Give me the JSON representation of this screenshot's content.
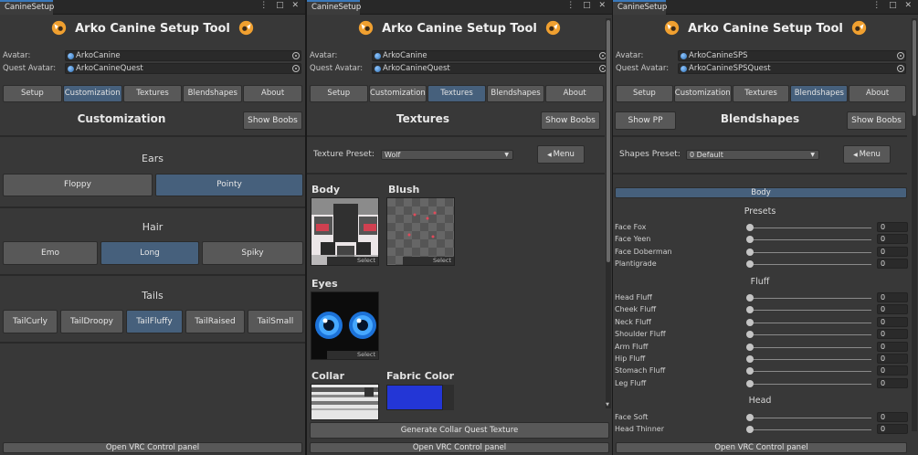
{
  "window_title": "CanineSetup",
  "header_title": "Arko Canine Setup Tool",
  "colors": {
    "active_tab": "#46607c",
    "accent": "#3a79bb",
    "panel_bg": "#383838"
  },
  "nav_tabs": [
    "Setup",
    "Customization",
    "Textures",
    "Blendshapes",
    "About"
  ],
  "bottom_button": "Open VRC Control panel",
  "show_boobs": "Show Boobs",
  "panel1": {
    "avatar_label": "Avatar:",
    "avatar_value": "ArkoCanine",
    "quest_label": "Quest Avatar:",
    "quest_value": "ArkoCanineQuest",
    "active_tab": "Customization",
    "section_title": "Customization",
    "groups": [
      {
        "title": "Ears",
        "options": [
          "Floppy",
          "Pointy"
        ],
        "selected": "Pointy"
      },
      {
        "title": "Hair",
        "options": [
          "Emo",
          "Long",
          "Spiky"
        ],
        "selected": "Long"
      },
      {
        "title": "Tails",
        "options": [
          "TailCurly",
          "TailDroopy",
          "TailFluffy",
          "TailRaised",
          "TailSmall"
        ],
        "selected": "TailFluffy"
      }
    ]
  },
  "panel2": {
    "avatar_label": "Avatar:",
    "avatar_value": "ArkoCanine",
    "quest_label": "Quest Avatar:",
    "quest_value": "ArkoCanineQuest",
    "active_tab": "Textures",
    "section_title": "Textures",
    "preset_label": "Texture Preset:",
    "preset_value": "Wolf",
    "menu_button": "Menu",
    "select_label": "Select",
    "textures": [
      "Body",
      "Blush",
      "Eyes",
      "Collar",
      "Fabric Color"
    ],
    "fabric_color": "#2336d6",
    "generate_button": "Generate Collar Quest Texture"
  },
  "panel3": {
    "avatar_label": "Avatar:",
    "avatar_value": "ArkoCanineSPS",
    "quest_label": "Quest Avatar:",
    "quest_value": "ArkoCanineSPSQuest",
    "active_tab": "Blendshapes",
    "section_title": "Blendshapes",
    "show_pp": "Show PP",
    "preset_label": "Shapes Preset:",
    "preset_value": "0 Default",
    "menu_button": "Menu",
    "body_button": "Body",
    "groups": [
      {
        "title": "Presets",
        "items": [
          {
            "name": "Face Fox",
            "value": "0"
          },
          {
            "name": "Face Yeen",
            "value": "0"
          },
          {
            "name": "Face Doberman",
            "value": "0"
          },
          {
            "name": "Plantigrade",
            "value": "0"
          }
        ]
      },
      {
        "title": "Fluff",
        "items": [
          {
            "name": "Head Fluff",
            "value": "0"
          },
          {
            "name": "Cheek Fluff",
            "value": "0"
          },
          {
            "name": "Neck Fluff",
            "value": "0"
          },
          {
            "name": "Shoulder Fluff",
            "value": "0"
          },
          {
            "name": "Arm Fluff",
            "value": "0"
          },
          {
            "name": "Hip Fluff",
            "value": "0"
          },
          {
            "name": "Stomach Fluff",
            "value": "0"
          },
          {
            "name": "Leg Fluff",
            "value": "0"
          }
        ]
      },
      {
        "title": "Head",
        "items": [
          {
            "name": "Face Soft",
            "value": "0"
          },
          {
            "name": "Head Thinner",
            "value": "0"
          }
        ]
      }
    ]
  }
}
